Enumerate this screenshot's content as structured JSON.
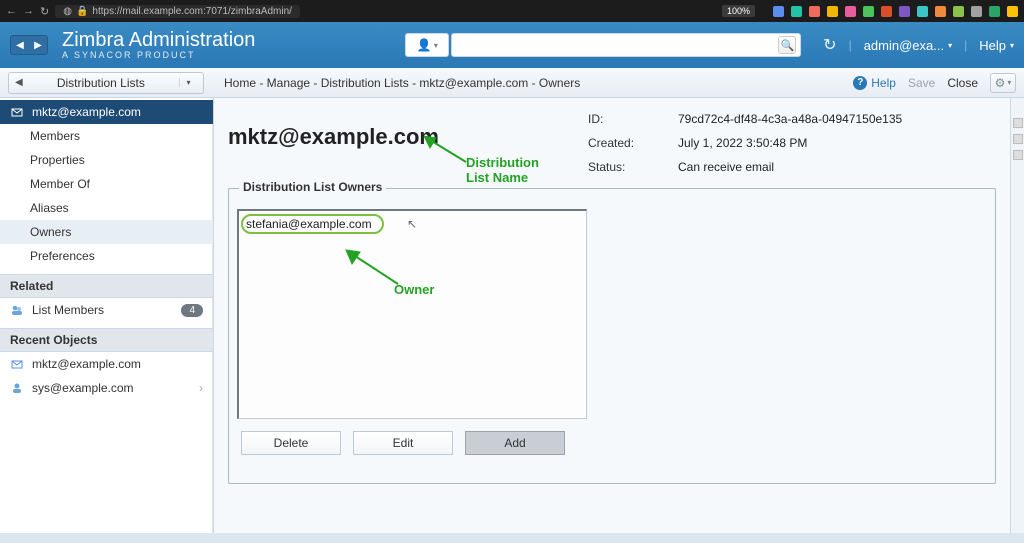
{
  "browser": {
    "url": "https://mail.example.com:7071/zimbraAdmin/",
    "zoom": "100%"
  },
  "header": {
    "brand_title": "Zimbra Administration",
    "brand_sub": "A SYNACOR PRODUCT",
    "search_placeholder": "",
    "user_label": "admin@exa...",
    "help_label": "Help"
  },
  "toolbar": {
    "sidebar_section": "Distribution Lists",
    "breadcrumb": "Home - Manage - Distribution Lists - mktz@example.com - Owners",
    "help": "Help",
    "save": "Save",
    "close": "Close"
  },
  "sidebar": {
    "top_item": "mktz@example.com",
    "nav": {
      "members": "Members",
      "properties": "Properties",
      "member_of": "Member Of",
      "aliases": "Aliases",
      "owners": "Owners",
      "preferences": "Preferences"
    },
    "related_header": "Related",
    "related": {
      "list_members": "List Members",
      "list_members_count": "4"
    },
    "recent_header": "Recent Objects",
    "recent": {
      "r1": "mktz@example.com",
      "r2": "sys@example.com"
    }
  },
  "main": {
    "dl_title": "mktz@example.com",
    "info": {
      "id_label": "ID:",
      "id_value": "79cd72c4-df48-4c3a-a48a-04947150e135",
      "created_label": "Created:",
      "created_value": "July 1, 2022 3:50:48 PM",
      "status_label": "Status:",
      "status_value": "Can receive email"
    },
    "owners_legend": "Distribution List Owners",
    "owners": {
      "row1": "stefania@example.com"
    },
    "buttons": {
      "delete": "Delete",
      "edit": "Edit",
      "add": "Add"
    }
  },
  "annotations": {
    "dl_name": "Distribution\nList Name",
    "owner": "Owner"
  }
}
